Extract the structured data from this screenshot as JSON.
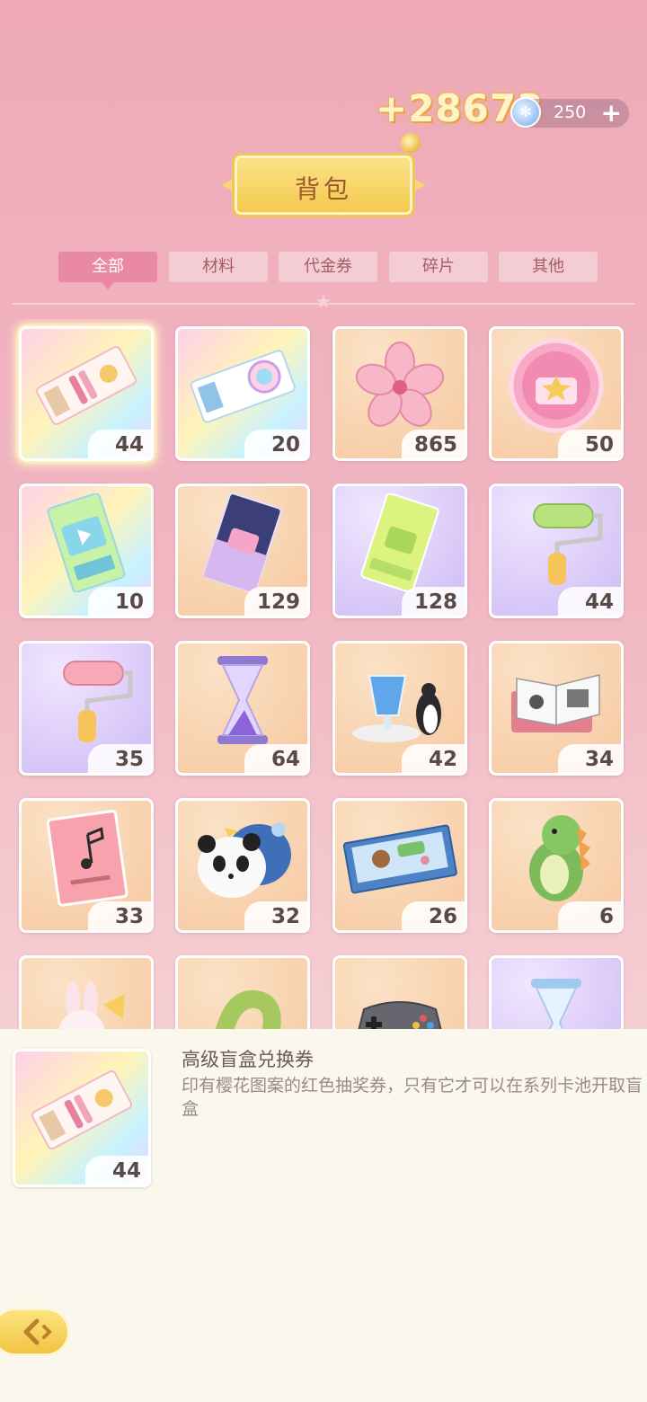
{
  "header": {
    "gain": "+28673",
    "currency_value": "250",
    "currency_plus": "+",
    "title": "背包"
  },
  "tabs": [
    {
      "label": "全部",
      "active": true
    },
    {
      "label": "材料",
      "active": false
    },
    {
      "label": "代金券",
      "active": false
    },
    {
      "label": "碎片",
      "active": false
    },
    {
      "label": "其他",
      "active": false
    }
  ],
  "items": [
    {
      "icon": "premium-blindbox-ticket-icon",
      "count": "44"
    },
    {
      "icon": "rainbow-ticket-icon",
      "count": "20"
    },
    {
      "icon": "sakura-flower-icon",
      "count": "865"
    },
    {
      "icon": "pink-bag-coin-icon",
      "count": "50"
    },
    {
      "icon": "video-ticket-icon",
      "count": "10"
    },
    {
      "icon": "navy-bag-ticket-icon",
      "count": "129"
    },
    {
      "icon": "green-bag-ticket-icon",
      "count": "128"
    },
    {
      "icon": "green-paint-roller-icon",
      "count": "44"
    },
    {
      "icon": "pink-paint-roller-icon",
      "count": "35"
    },
    {
      "icon": "hourglass-icon",
      "count": "64"
    },
    {
      "icon": "blue-drink-penguin-icon",
      "count": "42"
    },
    {
      "icon": "manga-books-icon",
      "count": "34"
    },
    {
      "icon": "music-notebook-icon",
      "count": "33"
    },
    {
      "icon": "panda-plush-icon",
      "count": "32"
    },
    {
      "icon": "puzzle-box-icon",
      "count": "26"
    },
    {
      "icon": "dinosaur-plush-icon",
      "count": "6"
    },
    {
      "icon": "bunny-plush-icon",
      "count": ""
    },
    {
      "icon": "green-scarf-icon",
      "count": ""
    },
    {
      "icon": "game-controller-icon",
      "count": ""
    },
    {
      "icon": "blue-hourglass-icon",
      "count": ""
    }
  ],
  "detail": {
    "name": "高级盲盒兑换券",
    "description": "印有樱花图案的红色抽奖券，只有它才可以在系列卡池开取盲盒",
    "count": "44"
  },
  "colors": {
    "accent": "#ea89a3",
    "tab_inactive": "#f4cdd4",
    "gold": "#f4c94c"
  }
}
